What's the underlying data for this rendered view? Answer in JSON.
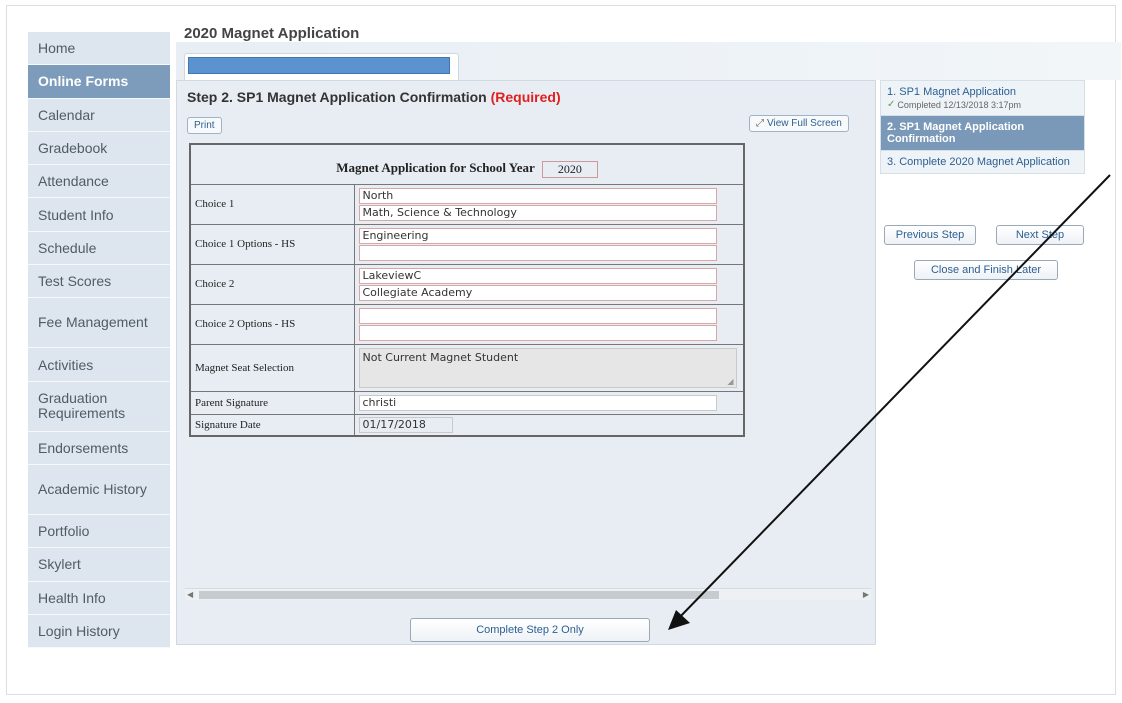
{
  "page": {
    "title": "2020 Magnet Application"
  },
  "sidebar": {
    "items": [
      {
        "label": "Home"
      },
      {
        "label": "Online Forms"
      },
      {
        "label": "Calendar"
      },
      {
        "label": "Gradebook"
      },
      {
        "label": "Attendance"
      },
      {
        "label": "Student Info"
      },
      {
        "label": "Schedule"
      },
      {
        "label": "Test Scores"
      },
      {
        "label": "Fee Management"
      },
      {
        "label": "Activities"
      },
      {
        "label": "Graduation Requirements"
      },
      {
        "label": "Endorsements"
      },
      {
        "label": "Academic History"
      },
      {
        "label": "Portfolio"
      },
      {
        "label": "Skylert"
      },
      {
        "label": "Health Info"
      },
      {
        "label": "Login History"
      }
    ],
    "active_index": 1
  },
  "main": {
    "step_title": "Step 2. SP1 Magnet Application Confirmation",
    "required_label": "(Required)",
    "print_label": "Print",
    "fullscreen_label": "View Full Screen",
    "complete_label": "Complete Step 2 Only"
  },
  "form": {
    "heading": "Magnet Application for School Year",
    "year": "2020",
    "rows": {
      "choice1": {
        "label": "Choice 1",
        "values": [
          "North",
          "Math, Science & Technology"
        ]
      },
      "choice1_options": {
        "label": "Choice 1 Options - HS",
        "values": [
          "Engineering",
          ""
        ]
      },
      "choice2": {
        "label": "Choice 2",
        "values": [
          "LakeviewC",
          "Collegiate Academy"
        ]
      },
      "choice2_options": {
        "label": "Choice 2 Options - HS",
        "values": [
          "",
          ""
        ]
      },
      "seat": {
        "label": "Magnet Seat Selection",
        "value": "Not Current Magnet Student"
      },
      "signature": {
        "label": "Parent Signature",
        "value": "christi"
      },
      "date": {
        "label": "Signature Date",
        "value": "01/17/2018"
      }
    }
  },
  "steps": {
    "items": [
      {
        "label": "1. SP1 Magnet Application",
        "meta": "Completed 12/13/2018 3:17pm"
      },
      {
        "label": "2. SP1 Magnet Application Confirmation"
      },
      {
        "label": "3. Complete 2020 Magnet Application"
      }
    ],
    "previous_label": "Previous Step",
    "next_label": "Next Step",
    "close_label": "Close and Finish Later"
  },
  "colors": {
    "sidebar_active": "#7d9cbc",
    "required": "#e02020",
    "progress": "#5a93cf",
    "link": "#2d5f93"
  }
}
